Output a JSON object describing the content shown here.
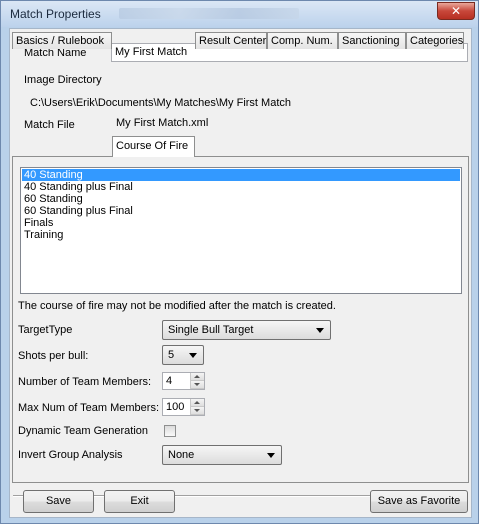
{
  "window": {
    "title": "Match Properties",
    "close_icon": "close-x"
  },
  "header": {
    "match_name_label": "Match Name",
    "match_name_value": "My First Match",
    "image_directory_label": "Image Directory",
    "image_directory_value": "C:\\Users\\Erik\\Documents\\My Matches\\My First Match",
    "match_file_label": "Match File",
    "match_file_value": "My First Match.xml"
  },
  "tabs": [
    {
      "label": "Basics / Rulebook"
    },
    {
      "label": "Course Of Fire",
      "active": true
    },
    {
      "label": "Result Center"
    },
    {
      "label": "Comp. Num."
    },
    {
      "label": "Sanctioning"
    },
    {
      "label": "Categories"
    }
  ],
  "course_of_fire": {
    "list": [
      {
        "label": "40 Standing",
        "selected": true
      },
      {
        "label": "40 Standing plus Final"
      },
      {
        "label": "60 Standing"
      },
      {
        "label": "60 Standing plus Final"
      },
      {
        "label": "Finals"
      },
      {
        "label": "Training"
      }
    ],
    "note": "The course of fire may not be modified after the match is created.",
    "target_type_label": "TargetType",
    "target_type_value": "Single Bull Target",
    "shots_per_bull_label": "Shots per bull:",
    "shots_per_bull_value": "5",
    "team_members_label": "Number of Team Members:",
    "team_members_value": "4",
    "max_team_members_label": "Max Num of Team Members:",
    "max_team_members_value": "100",
    "dynamic_team_label": "Dynamic Team Generation",
    "dynamic_team_checked": false,
    "invert_group_label": "Invert Group Analysis",
    "invert_group_value": "None"
  },
  "footer": {
    "save_label": "Save",
    "exit_label": "Exit",
    "favorite_label": "Save as Favorite"
  },
  "colors": {
    "selection": "#3399ff",
    "close_button": "#c8473a",
    "window_frame": "#b9d1ea"
  }
}
